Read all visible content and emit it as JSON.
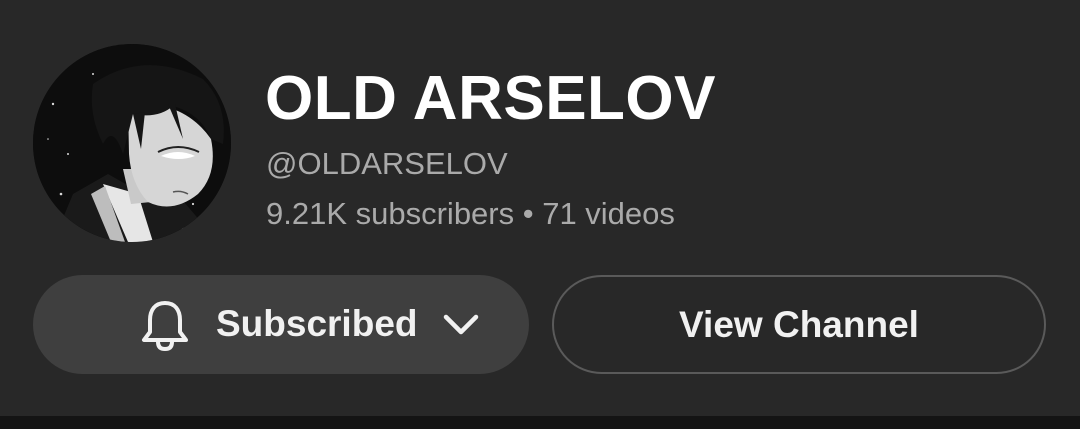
{
  "channel": {
    "title": "OLD ARSELOV",
    "handle": "@OLDARSELOV",
    "stats": "9.21K subscribers • 71 videos",
    "avatar": "anime-character-avatar"
  },
  "actions": {
    "subscribe_label": "Subscribed",
    "subscribe_icon": "bell-icon",
    "subscribe_menu_icon": "chevron-down-icon",
    "view_channel_label": "View Channel"
  },
  "colors": {
    "background": "#282828",
    "title": "#ffffff",
    "secondary_text": "#aaaaaa",
    "subscribe_button_bg": "#3f3f3f",
    "view_button_border": "#5a5a5a"
  }
}
